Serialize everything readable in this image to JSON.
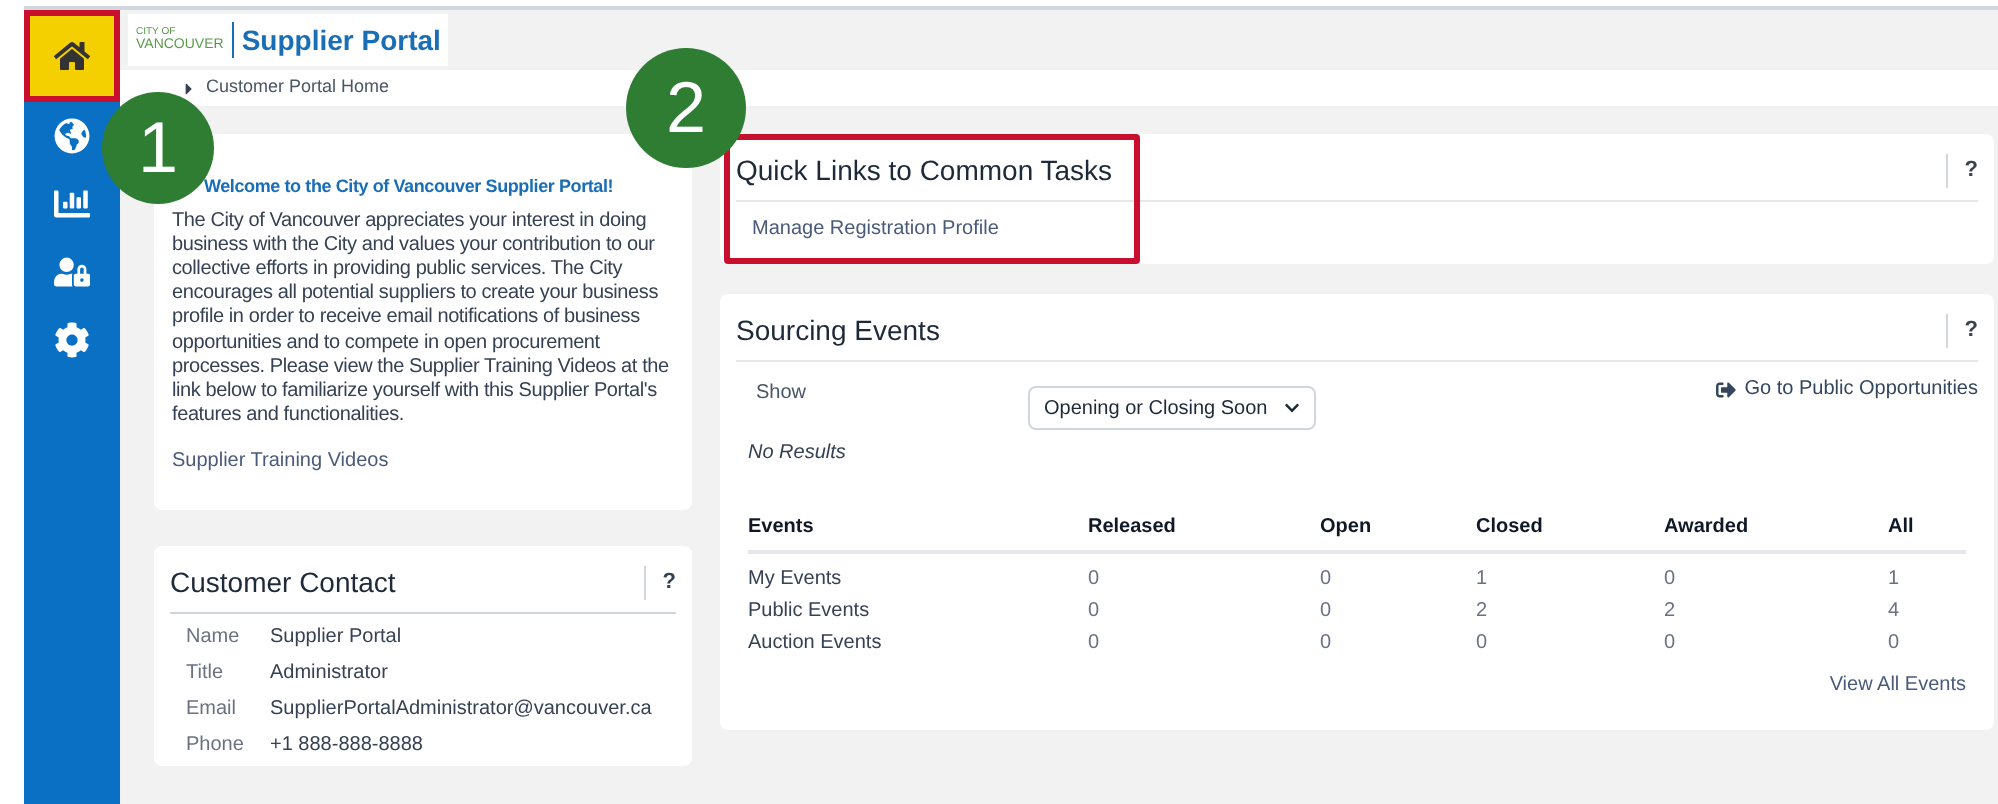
{
  "sidebar": {
    "items": [
      {
        "kind": "home",
        "selected": true
      },
      {
        "kind": "globe",
        "selected": false
      },
      {
        "kind": "chart",
        "selected": false
      },
      {
        "kind": "lock",
        "selected": false
      },
      {
        "kind": "gear",
        "selected": false
      }
    ]
  },
  "header": {
    "logo_lines": [
      "CITY OF",
      "VANCOUVER"
    ],
    "title": "Supplier Portal"
  },
  "breadcrumb": {
    "current": "Customer Portal Home"
  },
  "callouts": [
    "1",
    "2"
  ],
  "welcome": {
    "title": "Welcome to the City of Vancouver Supplier Portal!",
    "body": "The City of Vancouver appreciates your interest in doing business with the City and values your contribution to our collective efforts in providing public services. The City encourages all potential suppliers to create your business profile in order to receive email notifications of business opportunities and to compete in open procurement processes. Please view the Supplier Training Videos at the link below to familiarize yourself with this Supplier Portal's features and functionalities.",
    "link": "Supplier Training Videos"
  },
  "customer_contact": {
    "title": "Customer Contact",
    "help": "?",
    "fields": [
      {
        "label": "Name",
        "value": "Supplier Portal"
      },
      {
        "label": "Title",
        "value": "Administrator"
      },
      {
        "label": "Email",
        "value": "SupplierPortalAdministrator@vancouver.ca"
      },
      {
        "label": "Phone",
        "value": "+1 888-888-8888"
      }
    ]
  },
  "quick_links": {
    "title": "Quick Links to Common Tasks",
    "help": "?",
    "links": [
      "Manage Registration Profile"
    ]
  },
  "sourcing_events": {
    "title": "Sourcing Events",
    "help": "?",
    "show_label": "Show",
    "show_value": "Opening or Closing Soon",
    "public_link": "Go to Public Opportunities",
    "no_results": "No Results",
    "table": {
      "columns": [
        "Events",
        "Released",
        "Open",
        "Closed",
        "Awarded",
        "All"
      ],
      "rows": [
        [
          "My Events",
          "0",
          "0",
          "1",
          "0",
          "1"
        ],
        [
          "Public Events",
          "0",
          "0",
          "2",
          "2",
          "4"
        ],
        [
          "Auction Events",
          "0",
          "0",
          "0",
          "0",
          "0"
        ]
      ]
    },
    "view_all": "View All Events"
  }
}
